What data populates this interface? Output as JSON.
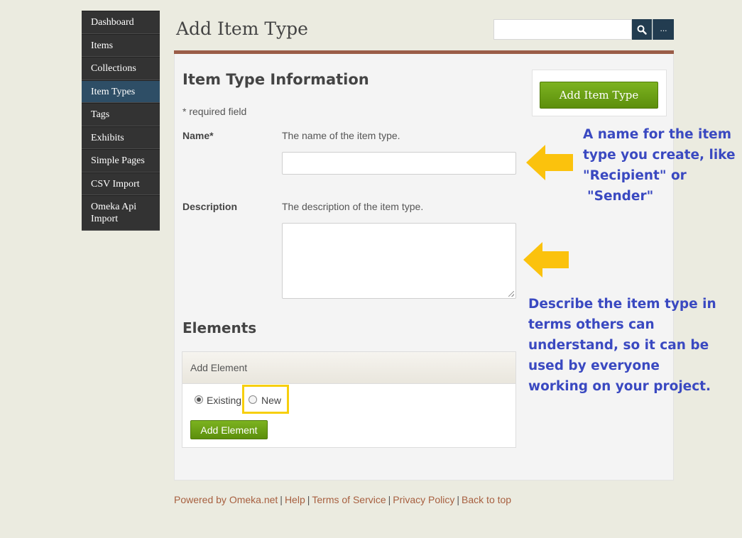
{
  "sidebar": {
    "items": [
      {
        "label": "Dashboard"
      },
      {
        "label": "Items"
      },
      {
        "label": "Collections"
      },
      {
        "label": "Item Types",
        "active": true
      },
      {
        "label": "Tags"
      },
      {
        "label": "Exhibits"
      },
      {
        "label": "Simple Pages"
      },
      {
        "label": "CSV Import"
      },
      {
        "label_line1": "Omeka Api",
        "label_line2": "Import"
      }
    ]
  },
  "header": {
    "title": "Add Item Type",
    "search_value": "",
    "search_icon": "search-icon",
    "more_label": "..."
  },
  "form": {
    "section_title": "Item Type Information",
    "required_note": "* required field",
    "name_label": "Name*",
    "name_hint": "The name of the item type.",
    "name_value": "",
    "description_label": "Description",
    "description_hint": "The description of the item type.",
    "description_value": ""
  },
  "actions": {
    "add_item_type_label": "Add Item Type"
  },
  "elements": {
    "title": "Elements",
    "panel_header": "Add Element",
    "radio_existing": "Existing",
    "radio_new": "New",
    "selected": "Existing",
    "add_button_label": "Add Element"
  },
  "annotations": {
    "name_note": [
      "A name for the item",
      "type you create, like",
      "\"Recipient\" or",
      "\"Sender\""
    ],
    "description_note": [
      "Describe the item type in",
      "terms others can",
      "understand, so it can be",
      "used by everyone",
      "working on your project."
    ],
    "arrow_color": "#fbc20d",
    "text_color": "#3a49c1",
    "highlight_color": "#f7cf0d"
  },
  "footer": {
    "powered_by": "Powered by Omeka.net",
    "help": "Help",
    "terms": "Terms of Service",
    "privacy": "Privacy Policy",
    "back_to_top": "Back to top",
    "separator": "|"
  },
  "colors": {
    "background": "#ebebe0",
    "nav_bg": "#333333",
    "nav_active": "#2e4e66",
    "accent_bar": "#9a5d48",
    "button_green": "#6ea116",
    "link": "#a75f3f"
  }
}
